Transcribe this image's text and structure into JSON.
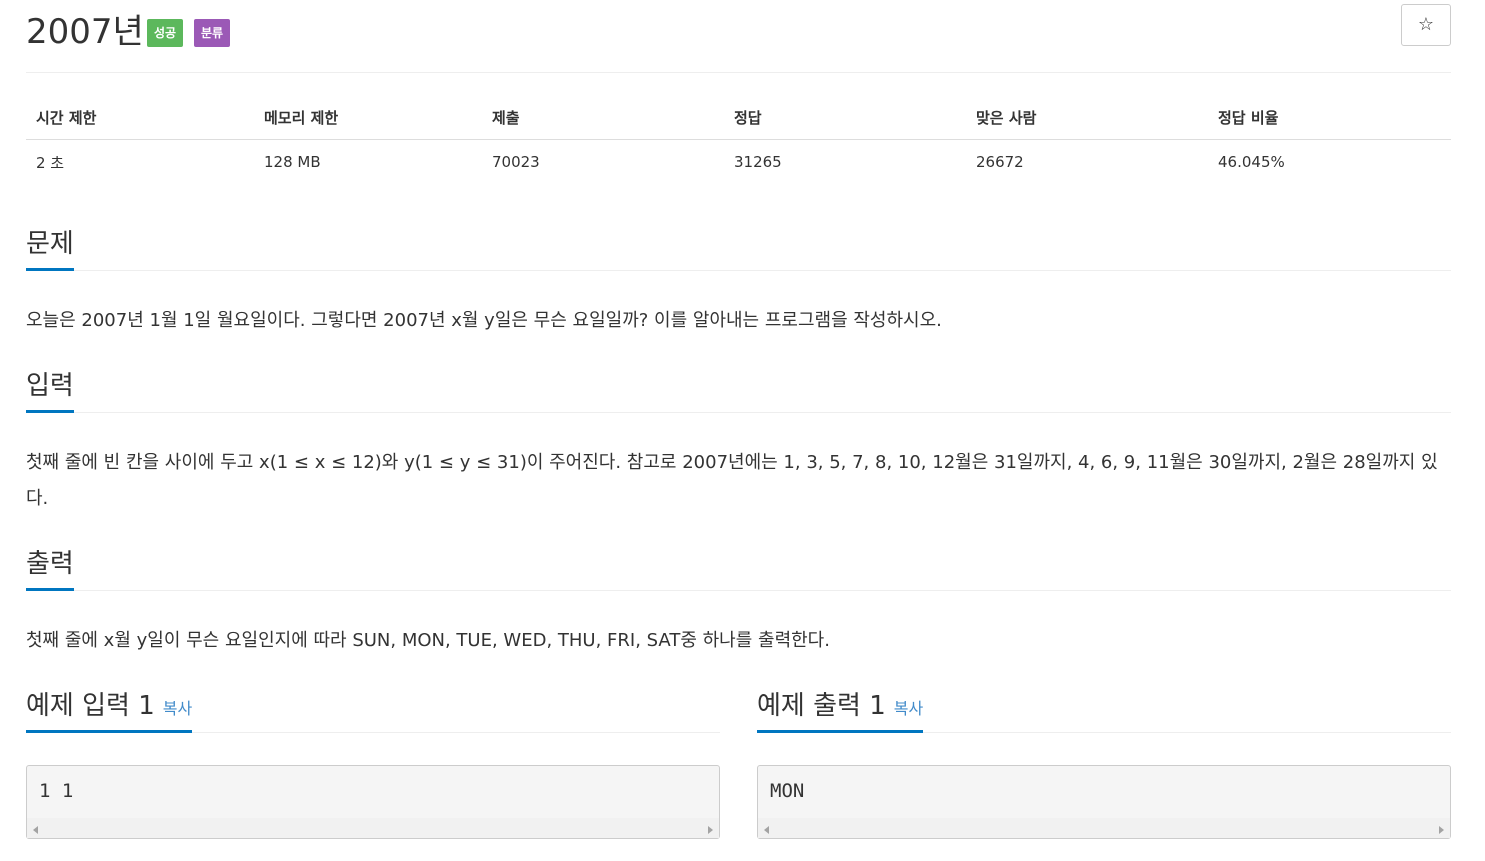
{
  "problem": {
    "title": "2007년",
    "badges": {
      "success": "성공",
      "category": "분류"
    },
    "star": "☆"
  },
  "info_table": {
    "headers": [
      "시간 제한",
      "메모리 제한",
      "제출",
      "정답",
      "맞은 사람",
      "정답 비율"
    ],
    "values": [
      "2 초",
      "128 MB",
      "70023",
      "31265",
      "26672",
      "46.045%"
    ]
  },
  "sections": {
    "problem": {
      "heading": "문제",
      "text": "오늘은 2007년 1월 1일 월요일이다. 그렇다면 2007년 x월 y일은 무슨 요일일까? 이를 알아내는 프로그램을 작성하시오."
    },
    "input": {
      "heading": "입력",
      "text": "첫째 줄에 빈 칸을 사이에 두고 x(1 ≤ x ≤ 12)와 y(1 ≤ y ≤ 31)이 주어진다. 참고로 2007년에는 1, 3, 5, 7, 8, 10, 12월은 31일까지, 4, 6, 9, 11월은 30일까지, 2월은 28일까지 있다."
    },
    "output": {
      "heading": "출력",
      "text": "첫째 줄에 x월 y일이 무슨 요일인지에 따라 SUN, MON, TUE, WED, THU, FRI, SAT중 하나를 출력한다."
    }
  },
  "samples": {
    "input": {
      "heading": "예제 입력 1",
      "copy": "복사",
      "content": "1 1"
    },
    "output": {
      "heading": "예제 출력 1",
      "copy": "복사",
      "content": "MON"
    }
  },
  "colors": {
    "accent": "#0076c0",
    "success": "#5cb85c",
    "category": "#9b59b6",
    "link": "#428bca"
  }
}
